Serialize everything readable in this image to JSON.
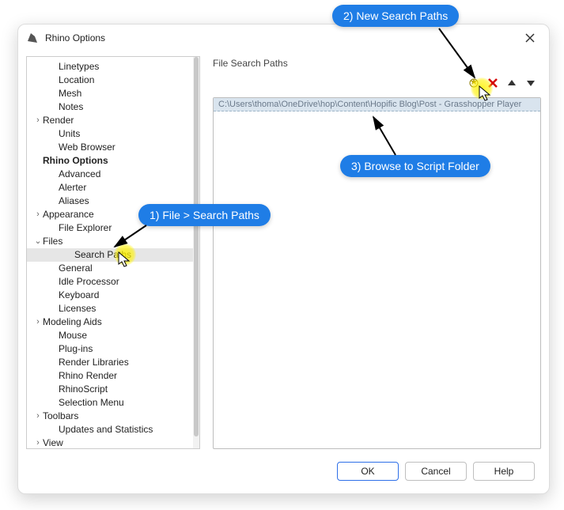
{
  "window": {
    "title": "Rhino Options"
  },
  "tree": [
    {
      "label": "Linetypes",
      "level": 1,
      "expander": ""
    },
    {
      "label": "Location",
      "level": 1,
      "expander": ""
    },
    {
      "label": "Mesh",
      "level": 1,
      "expander": ""
    },
    {
      "label": "Notes",
      "level": 1,
      "expander": ""
    },
    {
      "label": "Render",
      "level": 1,
      "expander": ">",
      "lvl0": true
    },
    {
      "label": "Units",
      "level": 1,
      "expander": ""
    },
    {
      "label": "Web Browser",
      "level": 1,
      "expander": ""
    },
    {
      "label": "Rhino Options",
      "level": 0,
      "expander": "",
      "bold": true
    },
    {
      "label": "Advanced",
      "level": 1,
      "expander": ""
    },
    {
      "label": "Alerter",
      "level": 1,
      "expander": ""
    },
    {
      "label": "Aliases",
      "level": 1,
      "expander": ""
    },
    {
      "label": "Appearance",
      "level": 1,
      "expander": ">",
      "lvl0": true
    },
    {
      "label": "File Explorer",
      "level": 1,
      "expander": ""
    },
    {
      "label": "Files",
      "level": 1,
      "expander": "v",
      "lvl0": true
    },
    {
      "label": "Search Paths",
      "level": 2,
      "expander": "",
      "selected": true
    },
    {
      "label": "General",
      "level": 1,
      "expander": ""
    },
    {
      "label": "Idle Processor",
      "level": 1,
      "expander": ""
    },
    {
      "label": "Keyboard",
      "level": 1,
      "expander": ""
    },
    {
      "label": "Licenses",
      "level": 1,
      "expander": ""
    },
    {
      "label": "Modeling Aids",
      "level": 1,
      "expander": ">",
      "lvl0": true
    },
    {
      "label": "Mouse",
      "level": 1,
      "expander": ""
    },
    {
      "label": "Plug-ins",
      "level": 1,
      "expander": ""
    },
    {
      "label": "Render Libraries",
      "level": 1,
      "expander": ""
    },
    {
      "label": "Rhino Render",
      "level": 1,
      "expander": ""
    },
    {
      "label": "RhinoScript",
      "level": 1,
      "expander": ""
    },
    {
      "label": "Selection Menu",
      "level": 1,
      "expander": ""
    },
    {
      "label": "Toolbars",
      "level": 1,
      "expander": ">",
      "lvl0": true
    },
    {
      "label": "Updates and Statistics",
      "level": 1,
      "expander": ""
    },
    {
      "label": "View",
      "level": 1,
      "expander": ">",
      "lvl0": true
    }
  ],
  "right": {
    "header": "File Search Paths",
    "paths": [
      "C:\\Users\\thoma\\OneDrive\\hop\\Content\\Hopific Blog\\Post - Grasshopper Player"
    ]
  },
  "buttons": {
    "ok": "OK",
    "cancel": "Cancel",
    "help": "Help"
  },
  "annotations": {
    "a1": "1) File > Search Paths",
    "a2": "2) New Search Paths",
    "a3": "3) Browse to Script Folder"
  }
}
